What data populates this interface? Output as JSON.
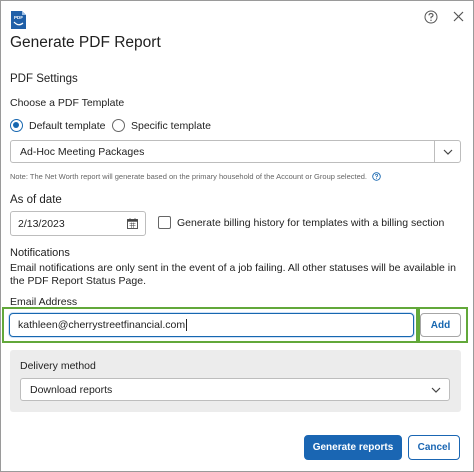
{
  "header": {
    "title": "Generate PDF Report",
    "app_icon_text": "PDF",
    "app_icon": "pdf-file-icon",
    "help_icon": "help-circle-icon",
    "close_icon": "close-icon"
  },
  "pdf_settings": {
    "heading": "PDF Settings",
    "template_label": "Choose a PDF Template",
    "options": [
      {
        "label": "Default template",
        "checked": true
      },
      {
        "label": "Specific template",
        "checked": false
      }
    ],
    "template_select_value": "Ad-Hoc Meeting Packages",
    "note": "Note: The Net Worth report will generate based on the primary household of the Account or Group selected."
  },
  "as_of_date": {
    "label": "As of date",
    "value": "2/13/2023",
    "billing_checkbox_label": "Generate billing history for templates with a billing section",
    "billing_checked": false
  },
  "notifications": {
    "heading": "Notifications",
    "text": "Email notifications are only sent in the event of a job failing. All other statuses will be available in the PDF Report Status Page.",
    "email_label": "Email Address",
    "email_value": "kathleen@cherrystreetfinancial.com",
    "add_label": "Add"
  },
  "delivery": {
    "label": "Delivery method",
    "value": "Download reports"
  },
  "footer": {
    "generate_label": "Generate reports",
    "cancel_label": "Cancel"
  },
  "colors": {
    "primary": "#1a66b3",
    "highlight": "#62a83a",
    "panel": "#ececec"
  }
}
